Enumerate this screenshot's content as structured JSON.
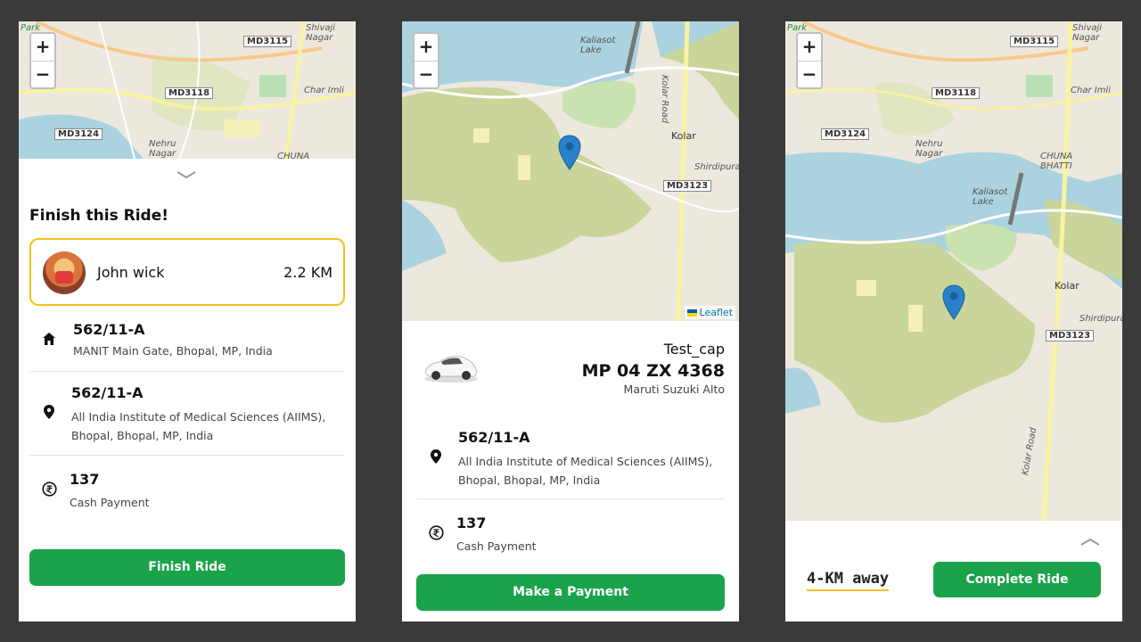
{
  "colors": {
    "accent_green": "#1aa34a",
    "highlight_yellow": "#f0c21c",
    "gutter": "#3a3a3a",
    "map_park": "#c9d59a",
    "map_water": "#aad3df",
    "map_road": "#f7f3a0"
  },
  "map_common": {
    "zoom_in": "+",
    "zoom_out": "−",
    "attribution": "Leaflet"
  },
  "panel1": {
    "map_labels": {
      "road1": "MD3115",
      "road2": "MD3118",
      "road3": "MD3124",
      "place1": "Park",
      "place2": "Nehru Nagar",
      "place3": "Shivaji Nagar",
      "place4": "Char Imli",
      "place5": "CHUNA"
    },
    "sheet_toggle_icon": "chevron-down-icon",
    "title": "Finish this Ride!",
    "rider": {
      "name": "John wick",
      "distance": "2.2 KM",
      "avatar_icon": "avatar"
    },
    "pickup": {
      "icon": "home-icon",
      "code": "562/11-A",
      "address": "MANIT Main Gate, Bhopal, MP, India"
    },
    "dropoff": {
      "icon": "location-pin-icon",
      "code": "562/11-A",
      "address_line1": "All India Institute of Medical Sciences (AIIMS),",
      "address_line2": "Bhopal, Bhopal, MP, India"
    },
    "fare": {
      "icon": "rupee-icon",
      "amount": "137",
      "method": "Cash Payment"
    },
    "button": "Finish Ride"
  },
  "panel2": {
    "map_labels": {
      "lake": "Kaliasot Lake",
      "road1": "Kolar Road",
      "area1": "Kolar",
      "area2": "Shirdipuram",
      "road2": "MD3123"
    },
    "vehicle": {
      "icon": "car-icon",
      "name": "Test_cap",
      "plate": "MP 04 ZX 4368",
      "model": "Maruti Suzuki Alto"
    },
    "dropoff": {
      "icon": "location-pin-icon",
      "code": "562/11-A",
      "address_line1": "All India Institute of Medical Sciences (AIIMS),",
      "address_line2": "Bhopal, Bhopal, MP, India"
    },
    "fare": {
      "icon": "rupee-icon",
      "amount": "137",
      "method": "Cash Payment"
    },
    "button": "Make a Payment"
  },
  "panel3": {
    "map_labels": {
      "road1": "MD3115",
      "road2": "MD3118",
      "road3": "MD3124",
      "road4": "MD3123",
      "place1": "Park",
      "place2": "Nehru Nagar",
      "place3": "Shivaji Nagar",
      "place4": "Char Imli",
      "place5": "CHUNA BHATTI",
      "lake": "Kaliasot Lake",
      "area1": "Kolar",
      "area2": "Shirdipuram",
      "road5": "Kolar Road"
    },
    "sheet_toggle_icon": "chevron-up-icon",
    "distance_away": "4-KM away",
    "button": "Complete Ride"
  }
}
